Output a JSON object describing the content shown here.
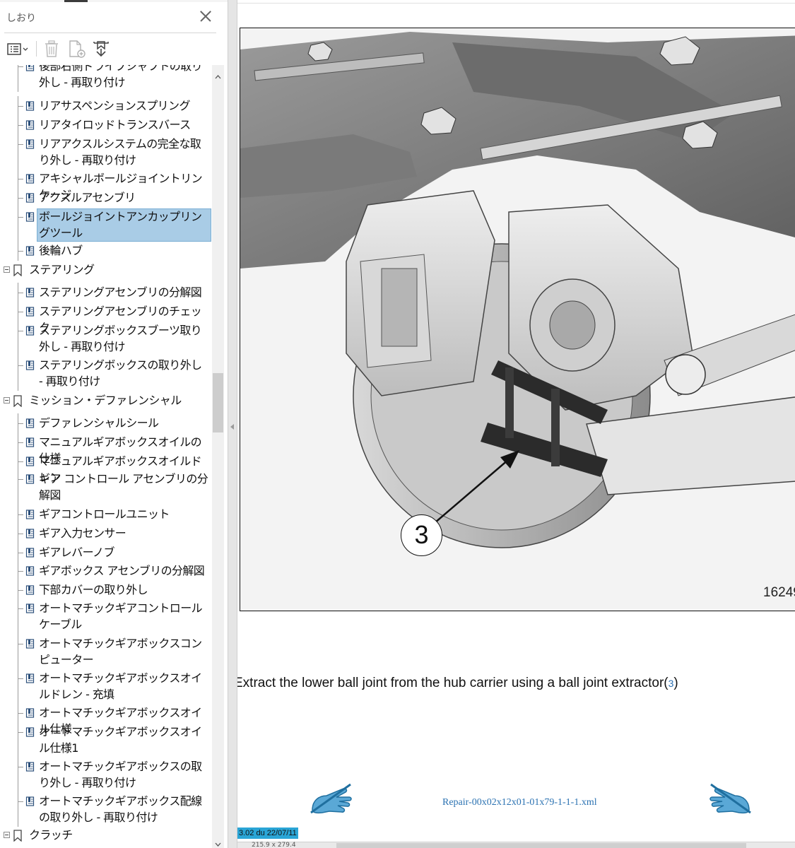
{
  "pane": {
    "title": "しおり",
    "toolbar": {
      "options_icon": "list-options-icon",
      "delete_icon": "trash-icon",
      "new_bookmark_icon": "new-bookmark-icon",
      "expand_icon": "expand-bookmark-icon"
    },
    "bookmarks": [
      {
        "label": "後部右側ドライブシャフトの取り外し - 再取り付け",
        "level": 2
      },
      {
        "label": "リアサスペンションスプリング",
        "level": 2
      },
      {
        "label": "リアタイロッドトランスバース",
        "level": 2
      },
      {
        "label": "リアアクスルシステムの完全な取り外し - 再取り付け",
        "level": 2
      },
      {
        "label": "アキシャルボールジョイントリンケージ",
        "level": 2
      },
      {
        "label": "アクスルアセンブリ",
        "level": 2
      },
      {
        "label": "ボールジョイントアンカップリングツール",
        "level": 2,
        "selected": true
      },
      {
        "label": "後輪ハブ",
        "level": 2
      },
      {
        "label": "ステアリング",
        "level": 1
      },
      {
        "label": "ステアリングアセンブリの分解図",
        "level": 2
      },
      {
        "label": "ステアリングアセンブリのチェック",
        "level": 2
      },
      {
        "label": "ステアリングボックスブーツ取り外し - 再取り付け",
        "level": 2
      },
      {
        "label": "ステアリングボックスの取り外し - 再取り付け",
        "level": 2
      },
      {
        "label": "ミッション・デファレンシャル",
        "level": 1
      },
      {
        "label": "デファレンシャルシール",
        "level": 2
      },
      {
        "label": "マニュアルギアボックスオイルの仕様",
        "level": 2
      },
      {
        "label": "マニュアルギアボックスオイルドレン",
        "level": 2
      },
      {
        "label": "ギア コントロール アセンブリの分解図",
        "level": 2
      },
      {
        "label": "ギアコントロールユニット",
        "level": 2
      },
      {
        "label": "ギア入力センサー",
        "level": 2
      },
      {
        "label": "ギアレバーノブ",
        "level": 2
      },
      {
        "label": "ギアボックス アセンブリの分解図",
        "level": 2
      },
      {
        "label": "下部カバーの取り外し",
        "level": 2
      },
      {
        "label": "オートマチックギアコントロールケーブル",
        "level": 2
      },
      {
        "label": "オートマチックギアボックスコンピューター",
        "level": 2
      },
      {
        "label": "オートマチックギアボックスオイルドレン - 充填",
        "level": 2
      },
      {
        "label": "オートマチックギアボックスオイル仕様",
        "level": 2
      },
      {
        "label": "オートマチックギアボックスオイル仕様1",
        "level": 2
      },
      {
        "label": "オートマチックギアボックスの取り外し - 再取り付け",
        "level": 2
      },
      {
        "label": "オートマチックギアボックス配線の取り外し - 再取り付け",
        "level": 2
      },
      {
        "label": "クラッチ",
        "level": 1
      }
    ]
  },
  "document": {
    "figure_callout": "3",
    "figure_code": "16249",
    "instruction_text": "Extract the lower ball joint from the hub carrier using a ball joint extractor(",
    "instruction_ref": "3",
    "instruction_close": ")",
    "xml_name": "Repair-00x02x12x01-01x79-1-1-1.xml",
    "version": "3.02 du 22/07/11",
    "status_text": "215.9 x 279.4",
    "nav_prev_icon": "previous-page-hand-icon",
    "nav_next_icon": "next-page-hand-icon"
  }
}
